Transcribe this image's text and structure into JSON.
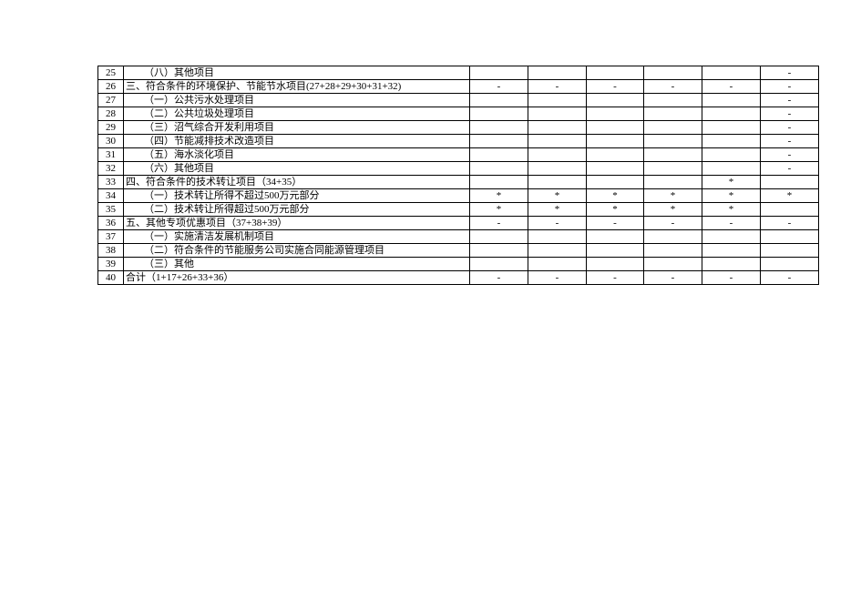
{
  "rows": [
    {
      "n": "25",
      "indent": 1,
      "label": "（八）其他项目",
      "v": [
        "",
        "",
        "",
        "",
        "",
        "-"
      ]
    },
    {
      "n": "26",
      "indent": 0,
      "label": "三、符合条件的环境保护、节能节水项目(27+28+29+30+31+32)",
      "v": [
        "-",
        "-",
        "-",
        "-",
        "-",
        "-"
      ]
    },
    {
      "n": "27",
      "indent": 1,
      "label": "（一）公共污水处理项目",
      "v": [
        "",
        "",
        "",
        "",
        "",
        "-"
      ]
    },
    {
      "n": "28",
      "indent": 1,
      "label": "（二）公共垃圾处理项目",
      "v": [
        "",
        "",
        "",
        "",
        "",
        "-"
      ]
    },
    {
      "n": "29",
      "indent": 1,
      "label": "（三）沼气综合开发利用项目",
      "v": [
        "",
        "",
        "",
        "",
        "",
        "-"
      ]
    },
    {
      "n": "30",
      "indent": 1,
      "label": "（四）节能减排技术改造项目",
      "v": [
        "",
        "",
        "",
        "",
        "",
        "-"
      ]
    },
    {
      "n": "31",
      "indent": 1,
      "label": "（五）海水淡化项目",
      "v": [
        "",
        "",
        "",
        "",
        "",
        "-"
      ]
    },
    {
      "n": "32",
      "indent": 1,
      "label": "（六）其他项目",
      "v": [
        "",
        "",
        "",
        "",
        "",
        "-"
      ]
    },
    {
      "n": "33",
      "indent": 0,
      "label": "四、符合条件的技术转让项目（34+35）",
      "v": [
        "",
        "",
        "",
        "",
        "*",
        ""
      ]
    },
    {
      "n": "34",
      "indent": 1,
      "label": "（一）技术转让所得不超过500万元部分",
      "v": [
        "*",
        "*",
        "*",
        "*",
        "*",
        "*"
      ]
    },
    {
      "n": "35",
      "indent": 1,
      "label": "（二）技术转让所得超过500万元部分",
      "v": [
        "*",
        "*",
        "*",
        "*",
        "*",
        ""
      ]
    },
    {
      "n": "36",
      "indent": 0,
      "label": "五、其他专项优惠项目（37+38+39）",
      "v": [
        "-",
        "-",
        "-",
        "-",
        "-",
        "-"
      ]
    },
    {
      "n": "37",
      "indent": 1,
      "label": "（一）实施清洁发展机制项目",
      "v": [
        "",
        "",
        "",
        "",
        "",
        ""
      ]
    },
    {
      "n": "38",
      "indent": 1,
      "label": "（二）符合条件的节能服务公司实施合同能源管理项目",
      "v": [
        "",
        "",
        "",
        "",
        "",
        ""
      ]
    },
    {
      "n": "39",
      "indent": 1,
      "label": "（三）其他",
      "v": [
        "",
        "",
        "",
        "",
        "",
        ""
      ]
    },
    {
      "n": "40",
      "indent": 0,
      "label": "合计（1+17+26+33+36）",
      "v": [
        "-",
        "-",
        "-",
        "-",
        "-",
        "-"
      ]
    }
  ]
}
